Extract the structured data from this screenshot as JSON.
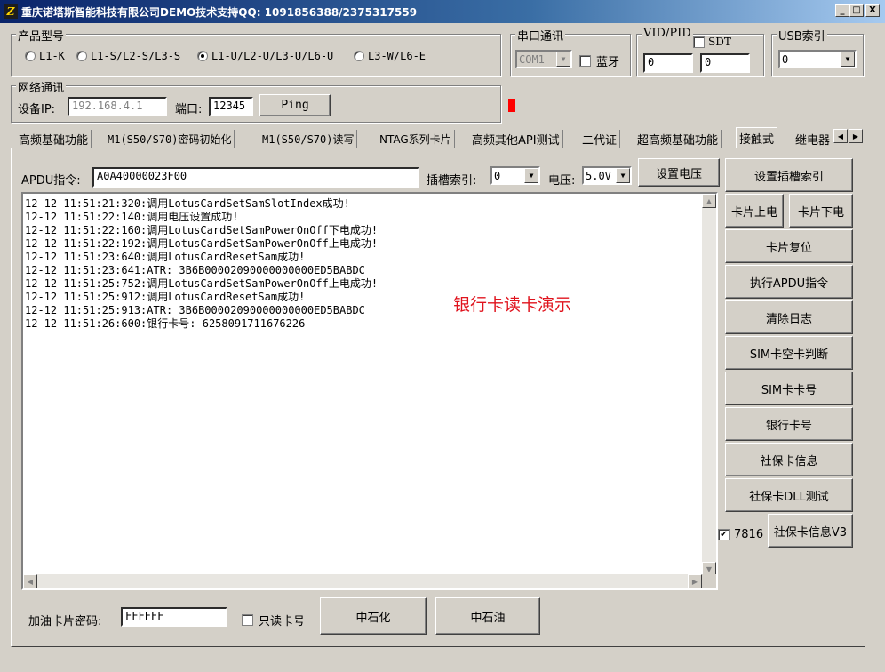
{
  "window": {
    "title": "重庆诺塔斯智能科技有限公司DEMO技术支持QQ: 1091856388/2375317559",
    "icon_letter": "Z",
    "controls": {
      "minimize": "_",
      "maximize": "□",
      "close": "X"
    }
  },
  "product": {
    "legend": "产品型号",
    "options": [
      "L1-K",
      "L1-S/L2-S/L3-S",
      "L1-U/L2-U/L3-U/L6-U",
      "L3-W/L6-E"
    ],
    "selected_index": 2
  },
  "serial": {
    "legend": "串口通讯",
    "port": "COM1",
    "bluetooth_label": "蓝牙",
    "bluetooth_checked": false
  },
  "vidpid": {
    "legend": "VID/PID",
    "sdt_label": "SDT",
    "sdt_checked": false,
    "vid": "0",
    "pid": "0"
  },
  "usb": {
    "legend": "USB索引",
    "value": "0"
  },
  "network": {
    "legend": "网络通讯",
    "ip_label": "设备IP:",
    "ip": "192.168.4.1",
    "port_label": "端口:",
    "port": "12345",
    "ping_label": "Ping"
  },
  "status_color": "#ff0000",
  "tabs": [
    "高频基础功能",
    "M1(S50/S70)密码初始化",
    "M1(S50/S70)读写",
    "NTAG系列卡片",
    "高频其他API测试",
    "二代证",
    "超高频基础功能",
    "接触式",
    "继电器"
  ],
  "active_tab_index": 7,
  "tab_scroll": {
    "left": "◀",
    "right": "▶"
  },
  "contact": {
    "apdu_label": "APDU指令:",
    "apdu_value": "A0A40000023F00",
    "slot_label": "插槽索引:",
    "slot_value": "0",
    "voltage_label": "电压:",
    "voltage_value": "5.0V",
    "set_voltage_label": "设置电压"
  },
  "log": {
    "lines": [
      "12-12 11:51:21:320:调用LotusCardSetSamSlotIndex成功!",
      "12-12 11:51:22:140:调用电压设置成功!",
      "12-12 11:51:22:160:调用LotusCardSetSamPowerOnOff下电成功!",
      "12-12 11:51:22:192:调用LotusCardSetSamPowerOnOff上电成功!",
      "12-12 11:51:23:640:调用LotusCardResetSam成功!",
      "12-12 11:51:23:641:ATR: 3B6B00002090000000000ED5BABDC",
      "12-12 11:51:25:752:调用LotusCardSetSamPowerOnOff上电成功!",
      "12-12 11:51:25:912:调用LotusCardResetSam成功!",
      "12-12 11:51:25:913:ATR: 3B6B00002090000000000ED5BABDC",
      "12-12 11:51:26:600:银行卡号: 6258091711676226"
    ],
    "overlay": "银行卡读卡演示",
    "overlay_color": "#e0141e"
  },
  "side_buttons": {
    "set_slot": "设置插槽索引",
    "power_on": "卡片上电",
    "power_off": "卡片下电",
    "reset": "卡片复位",
    "exec_apdu": "执行APDU指令",
    "clear_log": "清除日志",
    "sim_empty": "SIM卡空卡判断",
    "sim_number": "SIM卡卡号",
    "bank_number": "银行卡号",
    "social_info": "社保卡信息",
    "social_dll": "社保卡DLL测试",
    "social_v3": "社保卡信息V3"
  },
  "check_7816": {
    "label": "7816",
    "checked": true
  },
  "fuel": {
    "pwd_label": "加油卡片密码:",
    "pwd_value": "FFFFFF",
    "readonly_label": "只读卡号",
    "readonly_checked": false,
    "sinopec": "中石化",
    "petrochina": "中石油"
  }
}
